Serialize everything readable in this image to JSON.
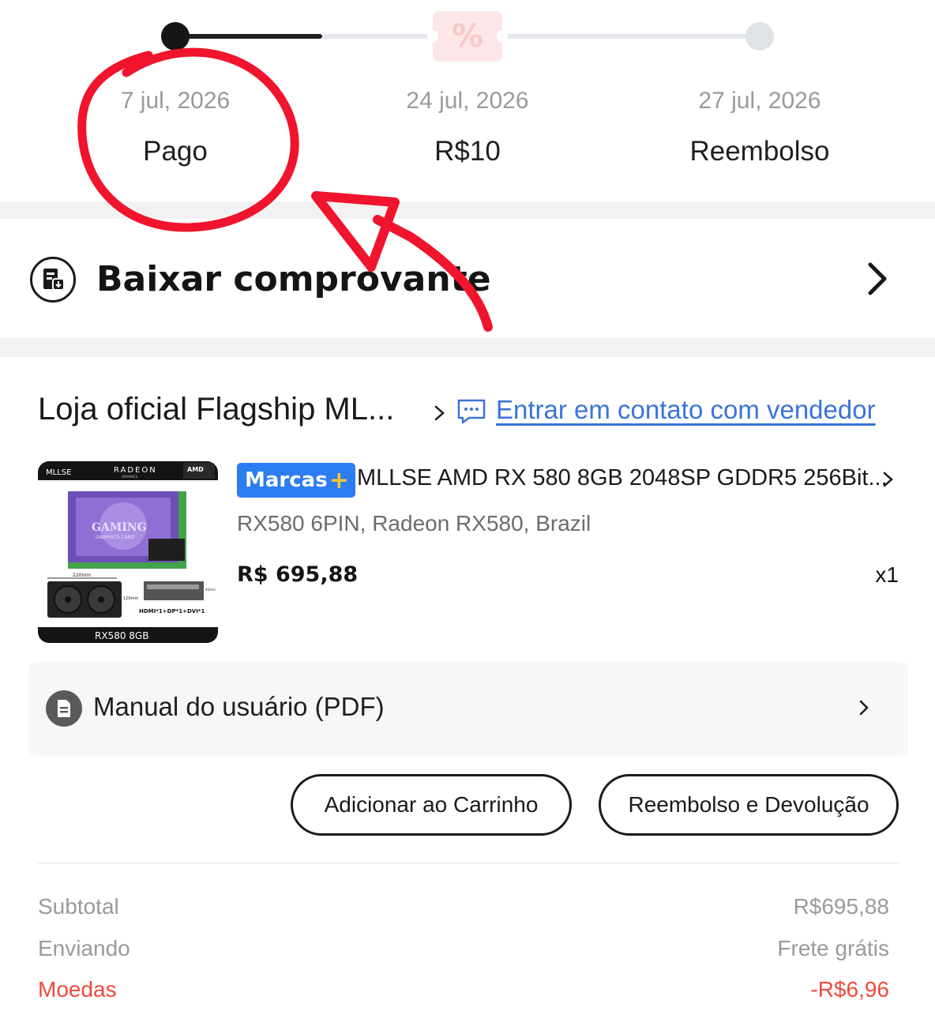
{
  "timeline": {
    "progress": 0.3,
    "coupon_icon": "percent-coupon-icon",
    "steps": [
      {
        "date": "7 jul, 2026",
        "label": "Pago"
      },
      {
        "date": "24 jul, 2026",
        "label": "R$10"
      },
      {
        "date": "27 jul, 2026",
        "label": "Reembolso"
      }
    ]
  },
  "receipt": {
    "icon": "receipt-download-icon",
    "label": "Baixar comprovante"
  },
  "store": {
    "name": "Loja oficial Flagship ML...",
    "contact_icon": "chat-bubble-icon",
    "contact_label": "Entrar em contato com vendedor"
  },
  "product": {
    "badge_text": "Marcas",
    "badge_plus": "+",
    "title": "MLLSE AMD RX 580 8GB 2048SP GDDR5 256Bit...",
    "variant": "RX580 6PIN, Radeon RX580, Brazil",
    "price": "R$ 695,88",
    "qty": "x1",
    "image": {
      "brand": "MLLSE",
      "series": "RADEON",
      "series_sub": "GRAPHICS",
      "amd": "AMD",
      "box_text": "GAMING",
      "box_sub": "GRAPHICS CARD",
      "dim_width": "220mm",
      "dim_height": "120mm",
      "dim_side": "42mm",
      "ports": "HDMI*1+DP*1+DVI*1",
      "footer": "RX580 8GB"
    }
  },
  "manual": {
    "icon": "document-icon",
    "label": "Manual do usuário (PDF)"
  },
  "actions": {
    "add_to_cart": "Adicionar ao Carrinho",
    "refund": "Reembolso e Devolução"
  },
  "summary": {
    "rows": [
      {
        "label": "Subtotal",
        "value": "R$695,88"
      },
      {
        "label": "Enviando",
        "value": "Frete grátis"
      },
      {
        "label": "Moedas",
        "value": "-R$6,96"
      }
    ]
  },
  "colors": {
    "link": "#3a74d8",
    "badge": "#2c7cf3",
    "discount": "#ef4a3c",
    "annotation": "#f0142c"
  }
}
